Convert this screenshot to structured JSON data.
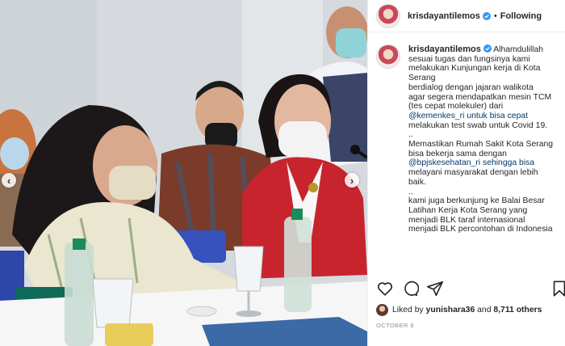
{
  "post": {
    "username": "krisdayantilemos",
    "follow_label": "Following",
    "caption_lines": [
      "Alhamdulillah",
      "sesuai tugas dan fungsinya kami",
      "melakukan Kunjungan kerja di Kota",
      "Serang",
      "berdialog dengan jajaran walikota",
      "agar segera mendapatkan mesin TCM",
      "(tes cepat molekuler) dari",
      "@kemenkes_ri untuk bisa cepat",
      "melakukan test swab untuk Covid 19.",
      "..",
      "Memastikan Rumah Sakit Kota Serang",
      "bisa bekerja sama dengan",
      "@bpjskesehatan_ri sehingga bisa",
      "melayani masyarakat dengan lebih",
      "baik.",
      "..",
      "kami juga berkunjung ke Balai Besar",
      "Latihan Kerja Kota Serang yang",
      "menjadi BLK taraf internasional",
      "menjadi BLK percontohan di Indonesia"
    ],
    "likes_prefix": "Liked by",
    "liked_by_user": "yunishara36",
    "likes_joiner": "and",
    "likes_count": "8,711 others",
    "date": "OCTOBER 8"
  },
  "colors": {
    "verified": "#3897f0",
    "mention": "#00376b",
    "muted": "#8e8e8e"
  },
  "icons": {
    "verified": "verified-badge-icon",
    "like": "heart-icon",
    "comment": "comment-icon",
    "share": "paper-plane-icon",
    "save": "bookmark-icon",
    "prev": "chevron-left-icon",
    "next": "chevron-right-icon"
  }
}
